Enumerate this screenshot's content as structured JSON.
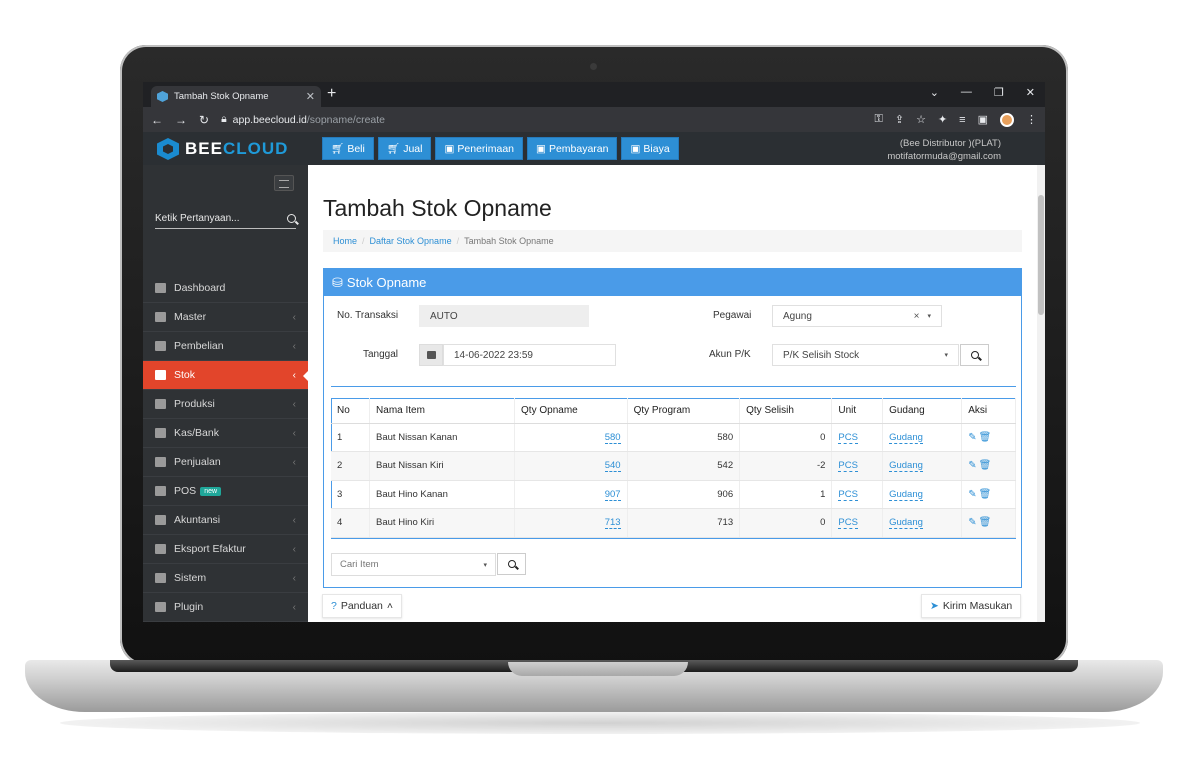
{
  "browser": {
    "tab_title": "Tambah Stok Opname",
    "url_host": "app.beecloud.id",
    "url_path": "/sopname/create"
  },
  "brand": {
    "part1": "BEE",
    "part2": "CLOUD"
  },
  "topnav": [
    {
      "label": "Beli",
      "icon": "cart-icon"
    },
    {
      "label": "Jual",
      "icon": "cart-icon"
    },
    {
      "label": "Penerimaan",
      "icon": "money-icon"
    },
    {
      "label": "Pembayaran",
      "icon": "money-icon"
    },
    {
      "label": "Biaya",
      "icon": "money-icon"
    }
  ],
  "user": {
    "company": "(Bee Distributor )(PLAT)",
    "email": "motifatormuda@gmail.com"
  },
  "sidebar": {
    "search_placeholder": "Ketik Pertanyaan...",
    "items": [
      {
        "label": "Dashboard",
        "icon": "home-icon"
      },
      {
        "label": "Master",
        "icon": "database-icon"
      },
      {
        "label": "Pembelian",
        "icon": "cart-icon"
      },
      {
        "label": "Stok",
        "icon": "box-icon",
        "active": true
      },
      {
        "label": "Produksi",
        "icon": "factory-icon"
      },
      {
        "label": "Kas/Bank",
        "icon": "money-icon"
      },
      {
        "label": "Penjualan",
        "icon": "cart-icon"
      },
      {
        "label": "POS",
        "icon": "monitor-icon",
        "badge": "new"
      },
      {
        "label": "Akuntansi",
        "icon": "chart-icon"
      },
      {
        "label": "Eksport Efaktur",
        "icon": "export-icon"
      },
      {
        "label": "Sistem",
        "icon": "gears-icon"
      },
      {
        "label": "Plugin",
        "icon": "puzzle-icon"
      }
    ]
  },
  "page": {
    "title": "Tambah Stok Opname",
    "breadcrumb": [
      "Home",
      "Daftar Stok Opname",
      "Tambah Stok Opname"
    ],
    "panel_title": "Stok Opname"
  },
  "form": {
    "no_transaksi_label": "No. Transaksi",
    "no_transaksi_value": "AUTO",
    "tanggal_label": "Tanggal",
    "tanggal_value": "14-06-2022 23:59",
    "pegawai_label": "Pegawai",
    "pegawai_value": "Agung",
    "akun_label": "Akun P/K",
    "akun_value": "P/K Selisih Stock"
  },
  "table": {
    "headers": [
      "No",
      "Nama Item",
      "Qty Opname",
      "Qty Program",
      "Qty Selisih",
      "Unit",
      "Gudang",
      "Aksi"
    ],
    "rows": [
      {
        "no": "1",
        "nama": "Baut Nissan Kanan",
        "opname": "580",
        "program": "580",
        "selisih": "0",
        "unit": "PCS",
        "gudang": "Gudang"
      },
      {
        "no": "2",
        "nama": "Baut Nissan Kiri",
        "opname": "540",
        "program": "542",
        "selisih": "-2",
        "unit": "PCS",
        "gudang": "Gudang"
      },
      {
        "no": "3",
        "nama": "Baut Hino Kanan",
        "opname": "907",
        "program": "906",
        "selisih": "1",
        "unit": "PCS",
        "gudang": "Gudang"
      },
      {
        "no": "4",
        "nama": "Baut Hino Kiri",
        "opname": "713",
        "program": "713",
        "selisih": "0",
        "unit": "PCS",
        "gudang": "Gudang"
      }
    ]
  },
  "cari_item_placeholder": "Cari Item",
  "footer": {
    "panduan": "Panduan",
    "kirim": "Kirim Masukan"
  }
}
